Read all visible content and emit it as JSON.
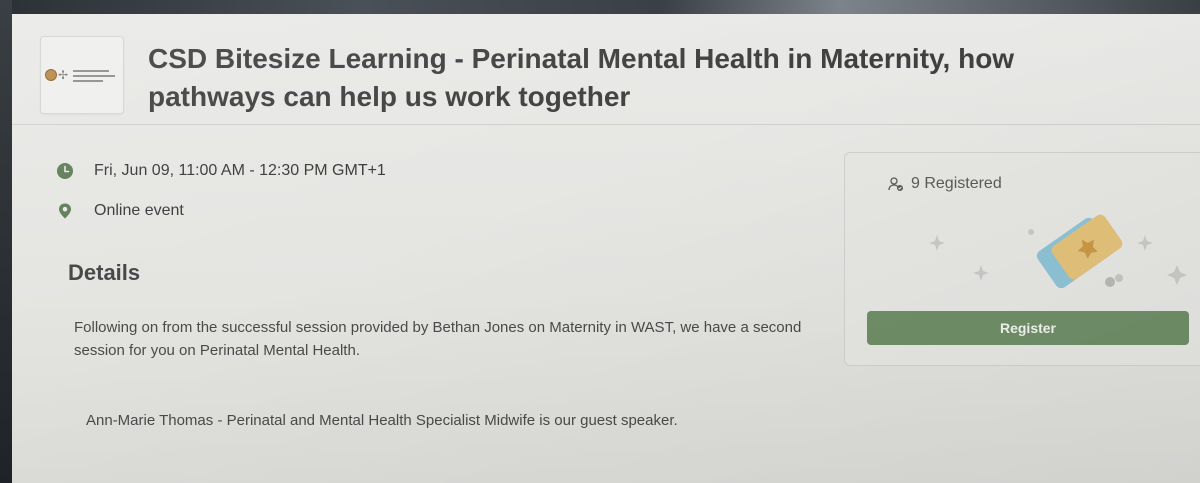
{
  "event": {
    "title": "CSD Bitesize Learning - Perinatal Mental Health in Maternity, how pathways can help us work together",
    "datetime": "Fri, Jun 09, 11:00 AM - 12:30 PM GMT+1",
    "location": "Online event",
    "details_heading": "Details",
    "description": "Following on from the successful session provided by Bethan Jones on Maternity in WAST, we have a second session for you on Perinatal Mental Health.",
    "speaker_note": "Ann-Marie Thomas - Perinatal and Mental Health Specialist Midwife is our guest speaker."
  },
  "sidebar_card": {
    "registered_text": "9 Registered",
    "register_label": "Register"
  },
  "icons": {
    "clock": "clock-icon",
    "location": "location-pin-icon",
    "people": "people-icon",
    "ticket": "ticket-illustration"
  },
  "colors": {
    "accent_green": "#6f8f68",
    "icon_green": "#5f7d57",
    "ticket_blue": "#8ec3d6",
    "ticket_gold": "#e3c27a"
  }
}
